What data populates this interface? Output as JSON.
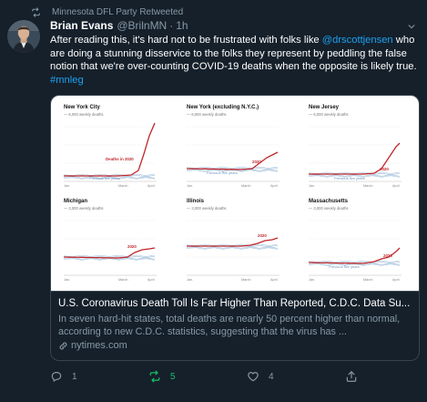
{
  "retweet": {
    "text": "Minnesota DFL Party Retweeted",
    "icon": "retweet-icon"
  },
  "tweet": {
    "author_name": "Brian Evans",
    "handle": "@BrilnMN",
    "dot": "·",
    "time": "1h",
    "text_parts": {
      "p1": "After reading this, it's hard not to be frustrated with folks like ",
      "mention": "@drscottjensen",
      "p2": " who are doing a stunning disservice to the folks they represent by peddling the false notion that we're over-counting COVID-19 deaths when the opposite is likely true. ",
      "hashtag": "#mnleg"
    }
  },
  "card": {
    "title": "U.S. Coronavirus Death Toll Is Far Higher Than Reported, C.D.C. Data Su...",
    "description": "In seven hard-hit states, total deaths are nearly 50 percent higher than normal, according to new C.D.C. statistics, suggesting that the virus has ...",
    "domain": "nytimes.com",
    "panels": [
      {
        "title": "New York City",
        "subtitle": "— 6,000 weekly deaths",
        "highlight": "Deaths in 2020",
        "baseline": "Previous five years",
        "x_ticks": [
          "Jan.",
          "March",
          "April"
        ]
      },
      {
        "title": "New York (excluding N.Y.C.)",
        "subtitle": "— 6,000 weekly deaths",
        "highlight": "2020",
        "baseline": "Previous five years",
        "x_ticks": [
          "Jan.",
          "March",
          "April"
        ]
      },
      {
        "title": "New Jersey",
        "subtitle": "— 6,000 weekly deaths",
        "highlight": "2020",
        "baseline": "Previous five years",
        "x_ticks": [
          "Jan.",
          "March",
          "April"
        ]
      },
      {
        "title": "Michigan",
        "subtitle": "— 3,000 weekly deaths",
        "highlight": "2020",
        "baseline": "",
        "x_ticks": [
          "Jan.",
          "March",
          "April"
        ]
      },
      {
        "title": "Illinois",
        "subtitle": "— 3,000 weekly deaths",
        "highlight": "2020",
        "baseline": "",
        "x_ticks": [
          "Jan.",
          "March",
          "April"
        ]
      },
      {
        "title": "Massachusetts",
        "subtitle": "— 3,000 weekly deaths",
        "highlight": "2020",
        "baseline": "Previous five years",
        "x_ticks": [
          "Jan.",
          "March",
          "April"
        ]
      }
    ]
  },
  "actions": {
    "replies": "1",
    "retweets": "5",
    "likes": "4"
  },
  "colors": {
    "background": "#15202b",
    "link": "#1da1f2",
    "muted": "#8899a6",
    "retweet": "#17bf63",
    "highlight_line": "#c0262b",
    "baseline_line": "#8fb3d3"
  }
}
